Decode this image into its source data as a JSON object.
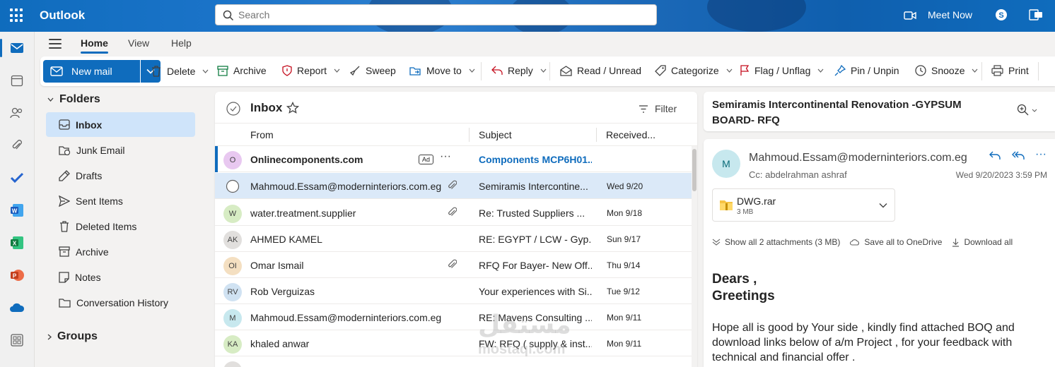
{
  "app": {
    "brand": "Outlook",
    "meet_now": "Meet Now"
  },
  "search": {
    "placeholder": "Search"
  },
  "ribbon": {
    "tabs": [
      "Home",
      "View",
      "Help"
    ]
  },
  "toolbar": {
    "new_mail": "New mail",
    "delete": "Delete",
    "archive": "Archive",
    "report": "Report",
    "sweep": "Sweep",
    "move_to": "Move to",
    "reply": "Reply",
    "read_unread": "Read / Unread",
    "categorize": "Categorize",
    "flag": "Flag / Unflag",
    "pin": "Pin / Unpin",
    "snooze": "Snooze",
    "print": "Print"
  },
  "folders": {
    "heading": "Folders",
    "items": [
      {
        "label": "Inbox",
        "icon": "inbox-icon"
      },
      {
        "label": "Junk Email",
        "icon": "junk-icon"
      },
      {
        "label": "Drafts",
        "icon": "pencil-icon"
      },
      {
        "label": "Sent Items",
        "icon": "send-icon"
      },
      {
        "label": "Deleted Items",
        "icon": "trash-icon"
      },
      {
        "label": "Archive",
        "icon": "archive-icon"
      },
      {
        "label": "Notes",
        "icon": "note-icon"
      },
      {
        "label": "Conversation History",
        "icon": "folder-icon"
      }
    ],
    "groups": "Groups"
  },
  "list": {
    "title": "Inbox",
    "filter": "Filter",
    "columns": {
      "from": "From",
      "subject": "Subject",
      "received": "Received..."
    },
    "ad_badge": "Ad",
    "rows": [
      {
        "initials": "O",
        "from": "Onlinecomponents.com",
        "subject": "Components MCP6H01...",
        "date": "",
        "avatar_color": "#e8c8f0"
      },
      {
        "initials": "",
        "from": "Mahmoud.Essam@moderninteriors.com.eg",
        "subject": "Semiramis Intercontine...",
        "date": "Wed 9/20",
        "avatar_color": ""
      },
      {
        "initials": "W",
        "from": "water.treatment.supplier",
        "subject": "Re:   Trusted Suppliers ...",
        "date": "Mon 9/18",
        "avatar_color": "#d7ecc4"
      },
      {
        "initials": "AK",
        "from": "AHMED KAMEL",
        "subject": "RE: EGYPT / LCW - Gyp...",
        "date": "Sun 9/17",
        "avatar_color": "#e1dfdd"
      },
      {
        "initials": "OI",
        "from": "Omar Ismail",
        "subject": "RFQ For Bayer- New Off...",
        "date": "Thu 9/14",
        "avatar_color": "#f4dfc1"
      },
      {
        "initials": "RV",
        "from": "Rob Verguizas",
        "subject": "Your experiences with Si...",
        "date": "Tue 9/12",
        "avatar_color": "#d0e2f2"
      },
      {
        "initials": "M",
        "from": "Mahmoud.Essam@moderninteriors.com.eg",
        "subject": "RE: Mavens Consulting ...",
        "date": "Mon 9/11",
        "avatar_color": "#c7e8ee"
      },
      {
        "initials": "KA",
        "from": "khaled anwar",
        "subject": "FW: RFQ ( supply & inst...",
        "date": "Mon 9/11",
        "avatar_color": "#d7ecc4"
      }
    ]
  },
  "reading": {
    "subject": "Semiramis Intercontinental Renovation -GYPSUM BOARD- RFQ",
    "avatar": "M",
    "from": "Mahmoud.Essam@moderninteriors.com.eg",
    "cc": "Cc:  abdelrahman ashraf",
    "date": "Wed 9/20/2023 3:59 PM",
    "attachment": {
      "name": "DWG.rar",
      "size": "3 MB"
    },
    "show_all": "Show all 2 attachments (3 MB)",
    "save_onedrive": "Save all to OneDrive",
    "download_all": "Download all",
    "greeting1": "Dears ,",
    "greeting2": "Greetings",
    "body": "Hope all is good by Your side , kindly find attached BOQ and download links below of a/m Project , for your feedback with technical and financial offer ."
  },
  "watermark": {
    "arabic": "مستقل",
    "latin": "mostaql.com"
  }
}
